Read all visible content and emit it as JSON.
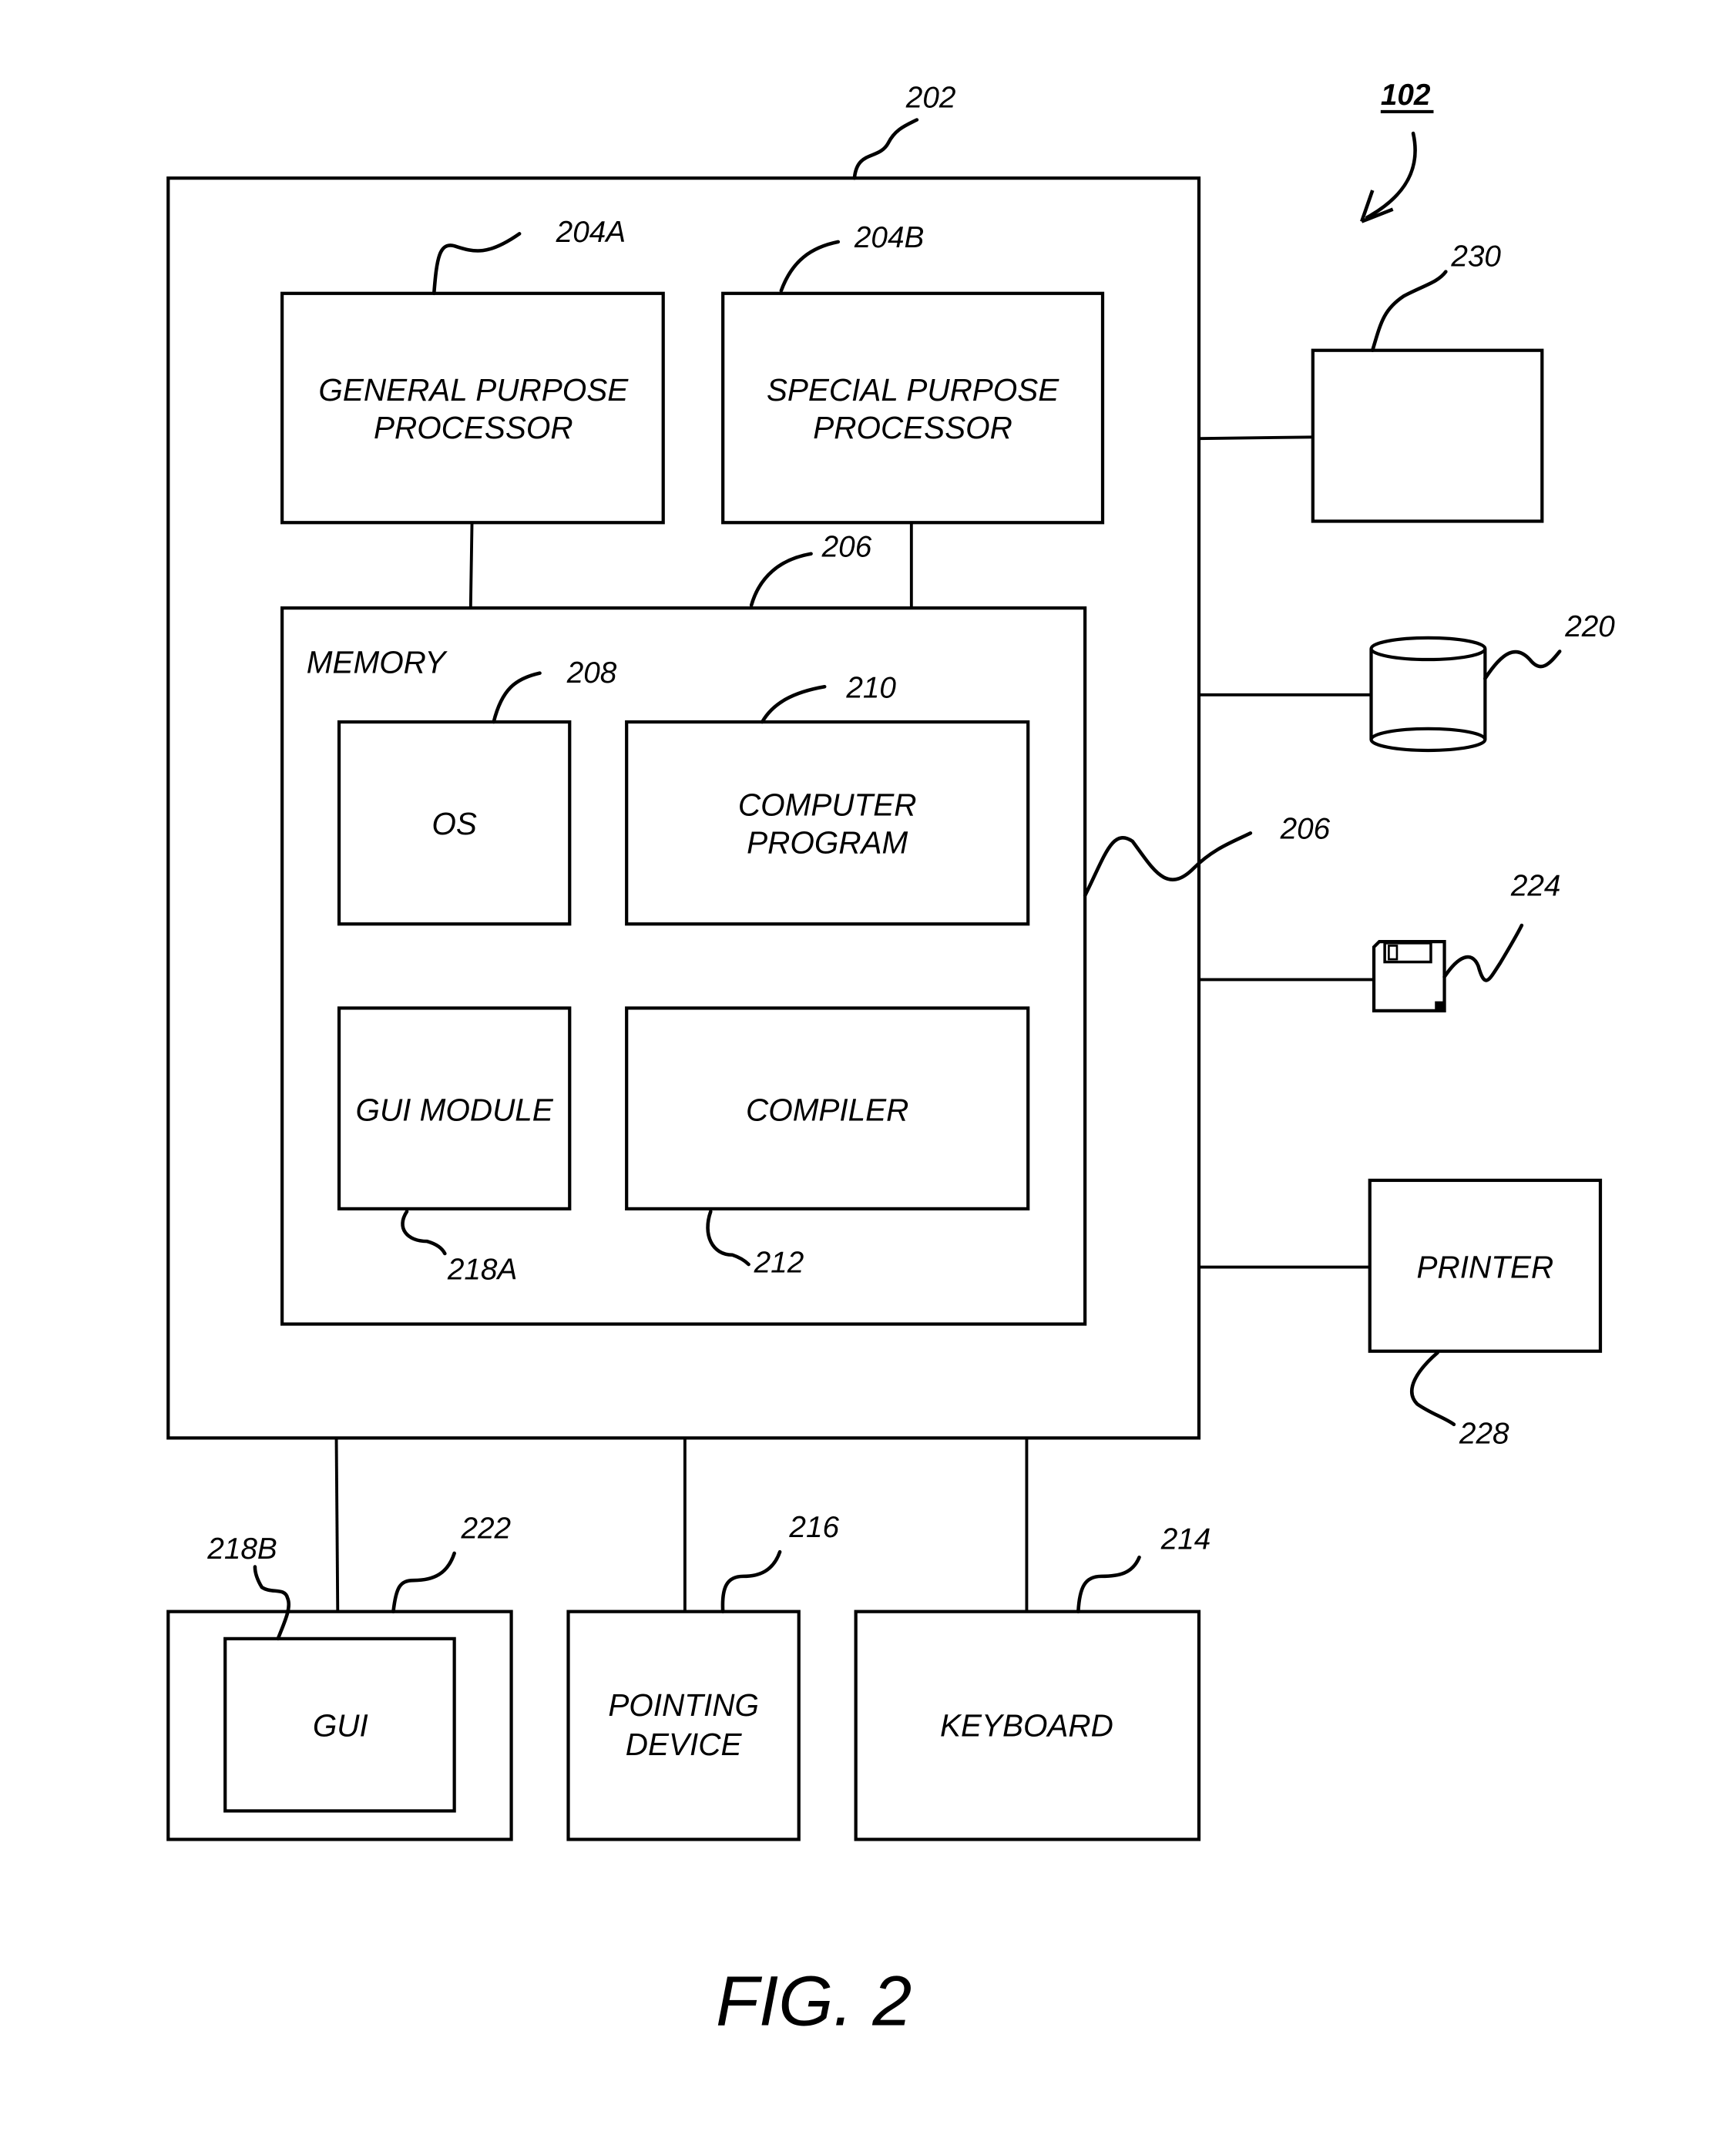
{
  "figure": {
    "caption": "FIG. 2",
    "system_ref": "102"
  },
  "computer": {
    "ref": "202",
    "gp_processor": {
      "ref": "204A",
      "line1": "GENERAL PURPOSE",
      "line2": "PROCESSOR"
    },
    "sp_processor": {
      "ref": "204B",
      "line1": "SPECIAL PURPOSE",
      "line2": "PROCESSOR"
    },
    "memory": {
      "label": "MEMORY",
      "ref_top": "206",
      "ref_side": "206",
      "os": {
        "ref": "208",
        "label": "OS"
      },
      "program": {
        "ref": "210",
        "line1": "COMPUTER",
        "line2": "PROGRAM"
      },
      "gui_module": {
        "ref": "218A",
        "label": "GUI MODULE"
      },
      "compiler": {
        "ref": "212",
        "label": "COMPILER"
      }
    }
  },
  "peripherals": {
    "device230": {
      "ref": "230"
    },
    "storage": {
      "ref": "220",
      "icon": "database-cylinder-icon"
    },
    "floppy": {
      "ref": "224",
      "icon": "floppy-disk-icon"
    },
    "printer": {
      "ref": "228",
      "label": "PRINTER"
    },
    "display": {
      "ref": "222",
      "gui_ref": "218B",
      "gui_label": "GUI"
    },
    "pointing": {
      "ref": "216",
      "line1": "POINTING",
      "line2": "DEVICE"
    },
    "keyboard": {
      "ref": "214",
      "label": "KEYBOARD"
    }
  }
}
